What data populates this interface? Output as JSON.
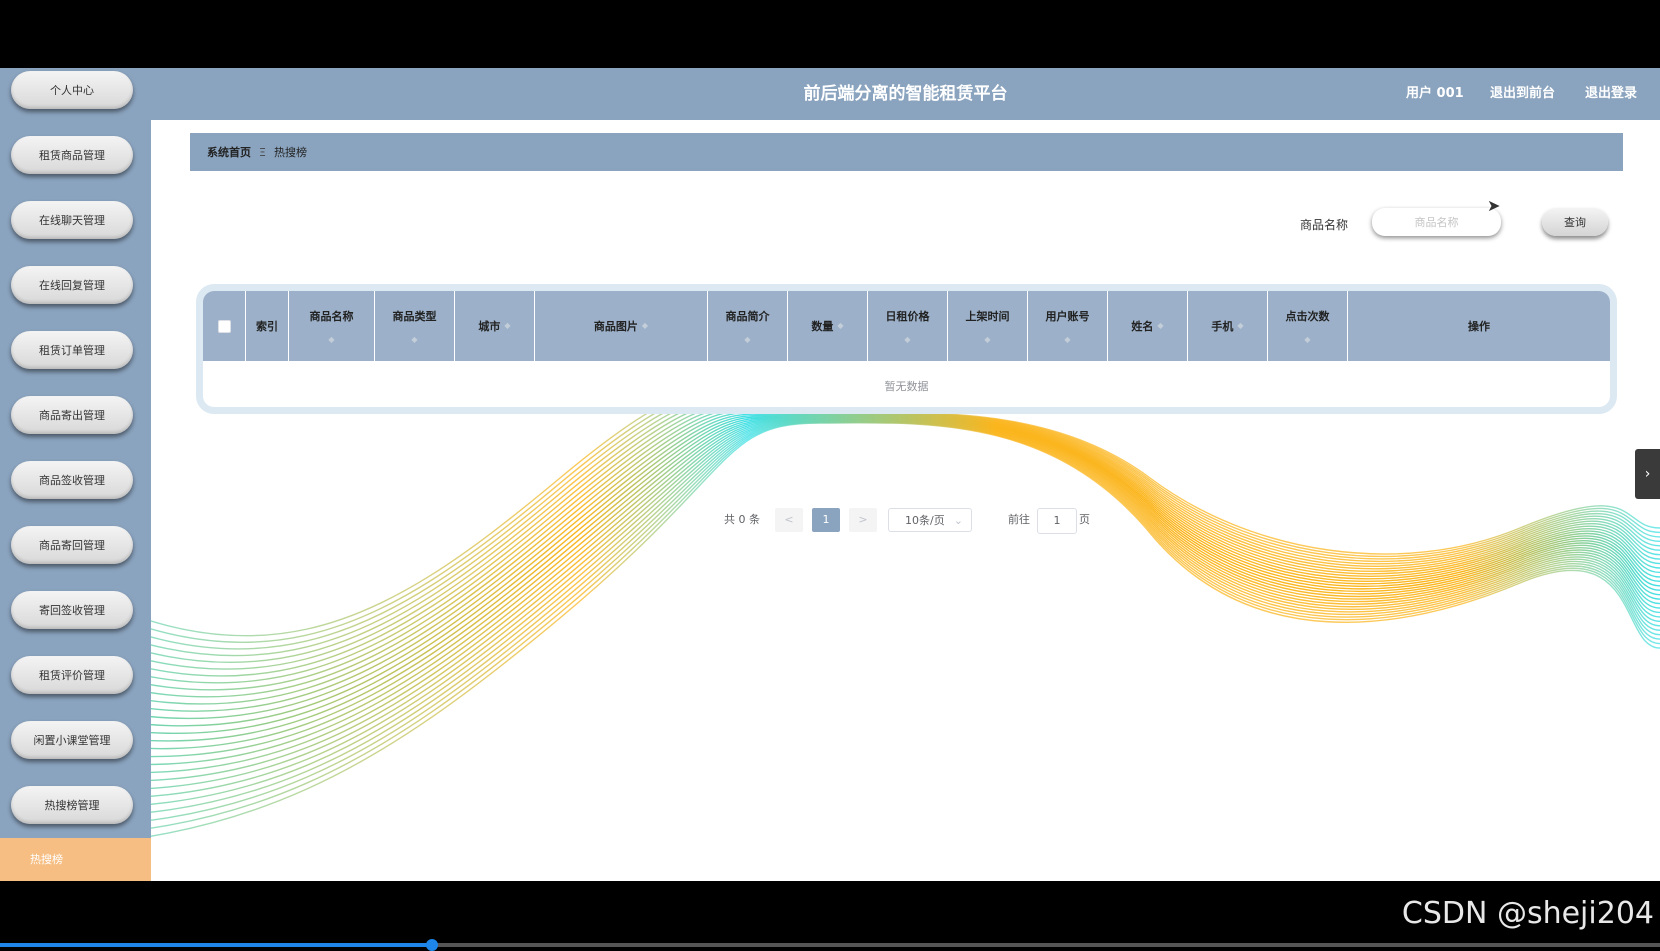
{
  "header": {
    "title": "前后端分离的智能租赁平台",
    "user": "用户 001",
    "back_to_front": "退出到前台",
    "logout": "退出登录"
  },
  "sidebar": {
    "items": [
      {
        "label": "个人中心"
      },
      {
        "label": "租赁商品管理"
      },
      {
        "label": "在线聊天管理"
      },
      {
        "label": "在线回复管理"
      },
      {
        "label": "租赁订单管理"
      },
      {
        "label": "商品寄出管理"
      },
      {
        "label": "商品签收管理"
      },
      {
        "label": "商品寄回管理"
      },
      {
        "label": "寄回签收管理"
      },
      {
        "label": "租赁评价管理"
      },
      {
        "label": "闲置小课堂管理"
      },
      {
        "label": "热搜榜管理"
      }
    ],
    "active_item": "热搜榜"
  },
  "breadcrumb": {
    "home": "系统首页",
    "separator": "Ξ",
    "current": "热搜榜"
  },
  "search": {
    "label": "商品名称",
    "placeholder": "商品名称",
    "button": "查询"
  },
  "table": {
    "columns": [
      "索引",
      "商品名称",
      "商品类型",
      "城市",
      "商品图片",
      "商品简介",
      "数量",
      "日租价格",
      "上架时间",
      "用户账号",
      "姓名",
      "手机",
      "点击次数",
      "操作"
    ],
    "empty_text": "暂无数据"
  },
  "pagination": {
    "total_text": "共 0 条",
    "prev": "<",
    "current_page": "1",
    "next": ">",
    "page_size": "10条/页",
    "goto_label": "前往",
    "goto_value": "1",
    "page_unit": "页"
  },
  "watermark": "CSDN @sheji204",
  "video_progress": 0.26,
  "colors": {
    "primary": "#8aa3be",
    "table_header": "#9cb1c9",
    "active_menu": "#f6be82",
    "wave_orange": "#fbb51c",
    "wave_cyan": "#3ee0e6"
  }
}
